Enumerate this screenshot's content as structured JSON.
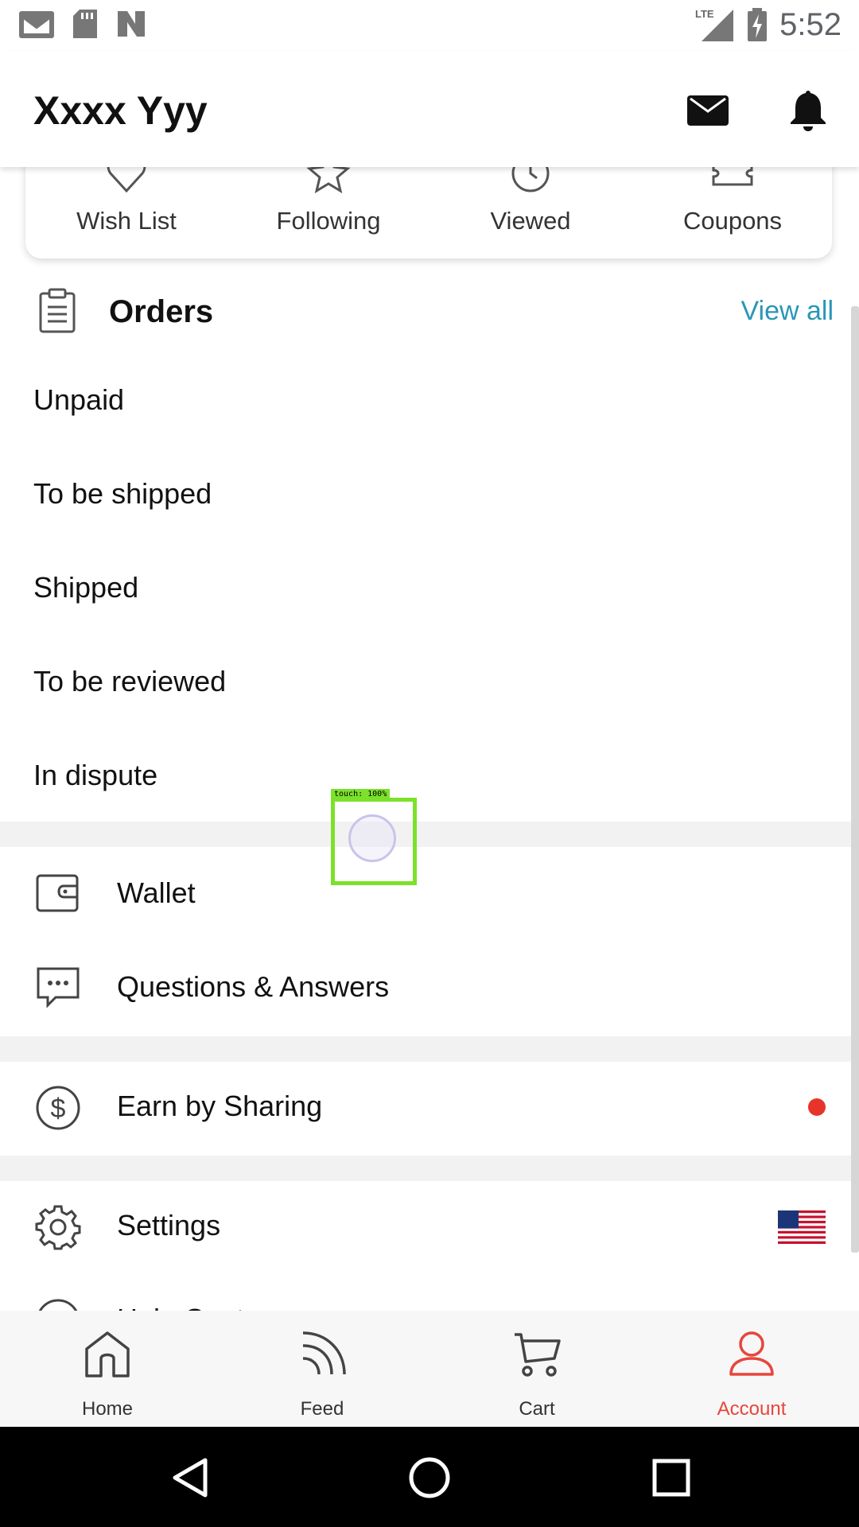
{
  "status_bar": {
    "time": "5:52",
    "network": "LTE",
    "left_icons": [
      "gmail-icon",
      "sd-card-icon",
      "n-app-icon"
    ],
    "right_icons": [
      "signal-icon",
      "battery-charging-icon"
    ]
  },
  "header": {
    "user_name": "Xxxx Yyy",
    "icons": [
      "mail-icon",
      "bell-icon"
    ]
  },
  "quick_links": [
    {
      "label": "Wish List",
      "icon": "heart-icon"
    },
    {
      "label": "Following",
      "icon": "star-icon"
    },
    {
      "label": "Viewed",
      "icon": "clock-icon"
    },
    {
      "label": "Coupons",
      "icon": "coupon-icon"
    }
  ],
  "orders": {
    "title": "Orders",
    "view_all": "View all",
    "items": [
      "Unpaid",
      "To be shipped",
      "Shipped",
      "To be reviewed",
      "In dispute"
    ]
  },
  "menu": {
    "wallet": "Wallet",
    "qa": "Questions & Answers",
    "earn": "Earn by Sharing",
    "settings": "Settings",
    "help": "Help Center"
  },
  "touch_overlay": {
    "label": "touch: 100%"
  },
  "bottom_nav": [
    {
      "label": "Home",
      "icon": "home-icon",
      "active": false
    },
    {
      "label": "Feed",
      "icon": "feed-icon",
      "active": false
    },
    {
      "label": "Cart",
      "icon": "cart-icon",
      "active": false
    },
    {
      "label": "Account",
      "icon": "account-icon",
      "active": true
    }
  ],
  "colors": {
    "accent": "#e8453c",
    "link": "#2a96b8",
    "touch_box": "#7ce12b"
  }
}
